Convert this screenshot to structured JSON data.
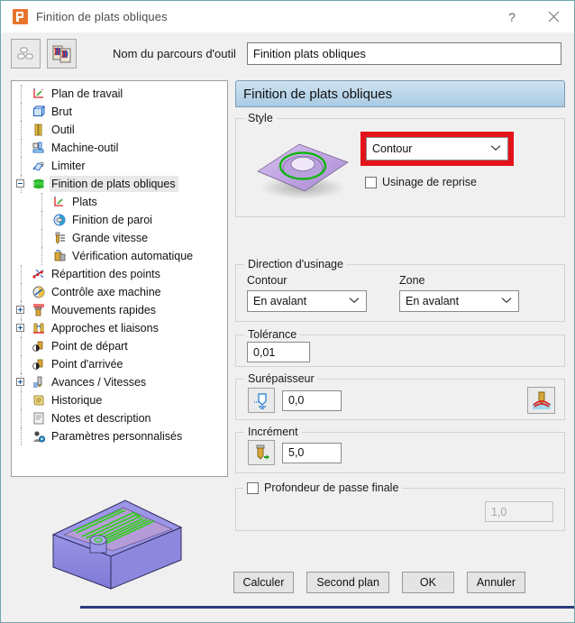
{
  "window": {
    "title": "Finition de plats obliques",
    "app_icon": "powermill-p-icon",
    "help_label": "?",
    "close_label": "✕"
  },
  "toolbar": {
    "buttons": [
      {
        "name": "recycle-reset-icon",
        "label": ""
      },
      {
        "name": "preview-thumbnails-icon",
        "label": ""
      }
    ],
    "toolpath_name_label": "Nom du parcours d'outil",
    "toolpath_name_value": "Finition plats obliques",
    "toolpath_name_placeholder": "Nom du parcours d'outil"
  },
  "tree": {
    "items": [
      {
        "label": "Plan de travail",
        "icon": "workplane-icon",
        "depth": 1,
        "expander": "none",
        "selected": false
      },
      {
        "label": "Brut",
        "icon": "block-cube-icon",
        "depth": 1,
        "expander": "none",
        "selected": false
      },
      {
        "label": "Outil",
        "icon": "tool-icon",
        "depth": 1,
        "expander": "none",
        "selected": false
      },
      {
        "label": "Machine-outil",
        "icon": "machine-tool-icon",
        "depth": 1,
        "expander": "none",
        "selected": false
      },
      {
        "label": "Limiter",
        "icon": "limit-icon",
        "depth": 1,
        "expander": "none",
        "selected": false
      },
      {
        "label": "Finition de plats obliques",
        "icon": "strategy-layers-icon",
        "depth": 1,
        "expander": "minus",
        "selected": true
      },
      {
        "label": "Plats",
        "icon": "flats-icon",
        "depth": 2,
        "expander": "none",
        "selected": false
      },
      {
        "label": "Finition de paroi",
        "icon": "wall-finishing-icon",
        "depth": 2,
        "expander": "none",
        "selected": false
      },
      {
        "label": "Grande vitesse",
        "icon": "high-speed-icon",
        "depth": 2,
        "expander": "none",
        "selected": false
      },
      {
        "label": "Vérification automatique",
        "icon": "auto-check-icon",
        "depth": 2,
        "expander": "none",
        "selected": false
      },
      {
        "label": "Répartition des points",
        "icon": "point-distribution-icon",
        "depth": 1,
        "expander": "none",
        "selected": false
      },
      {
        "label": "Contrôle axe machine",
        "icon": "machine-axis-icon",
        "depth": 1,
        "expander": "none",
        "selected": false
      },
      {
        "label": "Mouvements rapides",
        "icon": "rapid-moves-icon",
        "depth": 1,
        "expander": "plus",
        "selected": false
      },
      {
        "label": "Approches et liaisons",
        "icon": "leads-links-icon",
        "depth": 1,
        "expander": "plus",
        "selected": false
      },
      {
        "label": "Point de départ",
        "icon": "start-point-icon",
        "depth": 1,
        "expander": "none",
        "selected": false
      },
      {
        "label": "Point d'arrivée",
        "icon": "end-point-icon",
        "depth": 1,
        "expander": "none",
        "selected": false
      },
      {
        "label": "Avances / Vitesses",
        "icon": "feeds-speeds-icon",
        "depth": 1,
        "expander": "plus",
        "selected": false
      },
      {
        "label": "Historique",
        "icon": "history-icon",
        "depth": 1,
        "expander": "none",
        "selected": false
      },
      {
        "label": "Notes et description",
        "icon": "notes-icon",
        "depth": 1,
        "expander": "none",
        "selected": false
      },
      {
        "label": "Paramètres personnalisés",
        "icon": "user-settings-icon",
        "depth": 1,
        "expander": "none",
        "selected": false
      }
    ]
  },
  "preview": {
    "name": "toolpath-3d-preview",
    "body_color": "#8f8be0",
    "toolpath_color": "#2fd017",
    "pocket_color": "#b49bd8"
  },
  "panel": {
    "header": "Finition de plats obliques",
    "style": {
      "title": "Style",
      "illustration": "oblique-flat-contour-illustration",
      "combo_value": "Contour",
      "combo_highlighted": true,
      "highlight_color": "#e4131a",
      "checkbox_label": "Usinage de reprise",
      "checkbox_checked": false
    },
    "direction": {
      "title": "Direction d'usinage",
      "contour_label": "Contour",
      "contour_value": "En avalant",
      "zone_label": "Zone",
      "zone_value": "En avalant"
    },
    "tolerance": {
      "title": "Tolérance",
      "value": "0,01"
    },
    "thickness": {
      "title": "Surépaisseur",
      "left_icon": "thickness-radial-icon",
      "value": "0,0",
      "right_icon": "thickness-axial-icon"
    },
    "increment": {
      "title": "Incrément",
      "icon": "stepdown-icon",
      "value": "5,0"
    },
    "final_pass": {
      "label": "Profondeur de passe finale",
      "checked": false,
      "value": "1,0"
    }
  },
  "buttons": {
    "calculate": "Calculer",
    "background": "Second plan",
    "ok": "OK",
    "cancel": "Annuler"
  }
}
